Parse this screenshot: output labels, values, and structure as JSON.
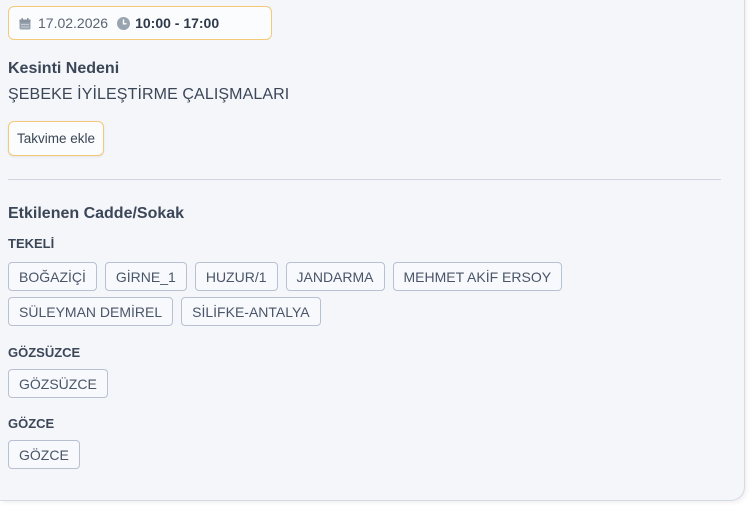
{
  "outage": {
    "date": "17.02.2026",
    "time": "10:00 - 17:00",
    "reason_title": "Kesinti Nedeni",
    "reason": "ŞEBEKE İYİLEŞTİRME ÇALIŞMALARI",
    "calendar_button": "Takvime ekle"
  },
  "affected": {
    "title": "Etkilenen Cadde/Sokak",
    "districts": [
      {
        "name": "TEKELİ",
        "streets_row1": [
          "BOĞAZİÇİ",
          "GİRNE_1",
          "HUZUR/1",
          "JANDARMA",
          "MEHMET AKİF ERSOY"
        ],
        "streets_row2": [
          "SÜLEYMAN DEMİREL",
          "SİLİFKE-ANTALYA"
        ]
      },
      {
        "name": "GÖZSÜZCE",
        "streets": [
          "GÖZSÜZCE"
        ]
      },
      {
        "name": "GÖZCE",
        "streets": [
          "GÖZCE"
        ]
      }
    ]
  },
  "icons": {
    "date": "calendar-icon",
    "time": "clock-icon"
  },
  "colors": {
    "accent_border": "#f5c97a",
    "card_background": "#f4f6fa",
    "text": "#3b4657",
    "tag_border": "#b7c1d2"
  }
}
